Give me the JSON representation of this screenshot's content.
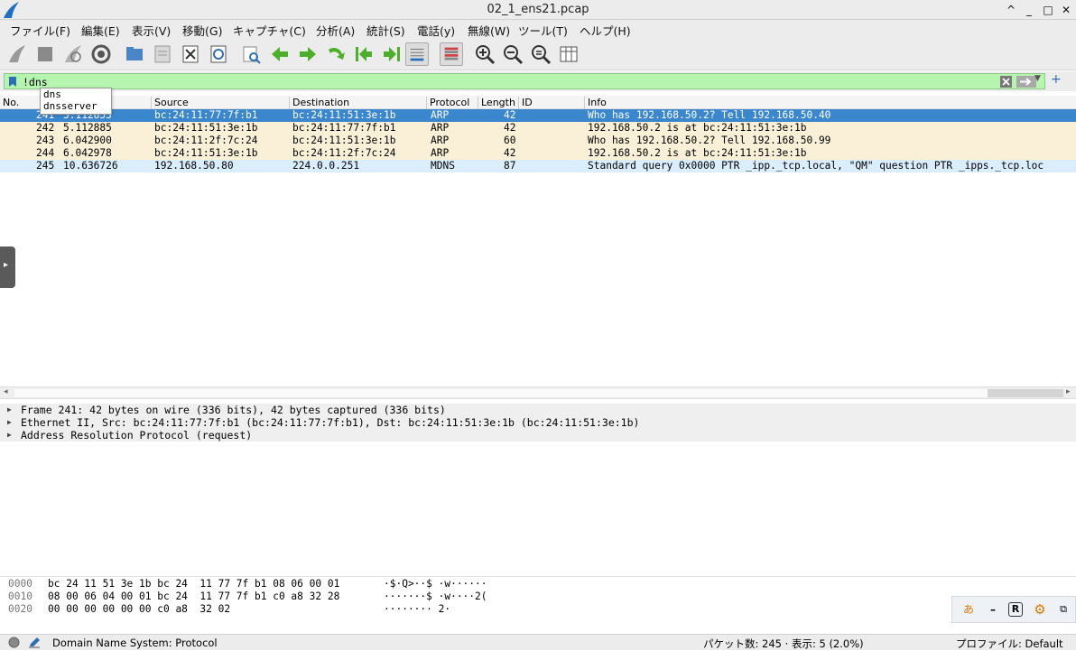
{
  "window": {
    "title": "02_1_ens21.pcap",
    "controls": [
      "^",
      "_",
      "□",
      "✕"
    ]
  },
  "menu": [
    "ファイル(F)",
    "編集(E)",
    "表示(V)",
    "移動(G)",
    "キャプチャ(C)",
    "分析(A)",
    "統計(S)",
    "電話(y)",
    "無線(W)",
    "ツール(T)",
    "ヘルプ(H)"
  ],
  "filter": {
    "value": "!dns",
    "suggestions": [
      "dns",
      "dnsserver"
    ]
  },
  "columns": [
    "No.",
    "Source",
    "Destination",
    "Protocol",
    "Length",
    "ID",
    "Info"
  ],
  "packets": [
    {
      "no": "241",
      "time": "5.112853",
      "src": "bc:24:11:77:7f:b1",
      "dst": "bc:24:11:51:3e:1b",
      "proto": "ARP",
      "len": "42",
      "info": "Who has 192.168.50.2? Tell 192.168.50.40",
      "kind": "sel"
    },
    {
      "no": "242",
      "time": "5.112885",
      "src": "bc:24:11:51:3e:1b",
      "dst": "bc:24:11:77:7f:b1",
      "proto": "ARP",
      "len": "42",
      "info": "192.168.50.2 is at bc:24:11:51:3e:1b",
      "kind": "arp"
    },
    {
      "no": "243",
      "time": "6.042900",
      "src": "bc:24:11:2f:7c:24",
      "dst": "bc:24:11:51:3e:1b",
      "proto": "ARP",
      "len": "60",
      "info": "Who has 192.168.50.2? Tell 192.168.50.99",
      "kind": "arp"
    },
    {
      "no": "244",
      "time": "6.042978",
      "src": "bc:24:11:51:3e:1b",
      "dst": "bc:24:11:2f:7c:24",
      "proto": "ARP",
      "len": "42",
      "info": "192.168.50.2 is at bc:24:11:51:3e:1b",
      "kind": "arp"
    },
    {
      "no": "245",
      "time": "10.636726",
      "src": "192.168.50.80",
      "dst": "224.0.0.251",
      "proto": "MDNS",
      "len": "87",
      "info": "Standard query 0x0000 PTR _ipp._tcp.local, \"QM\" question PTR _ipps._tcp.loc",
      "kind": "udp"
    }
  ],
  "details": [
    "Frame 241: 42 bytes on wire (336 bits), 42 bytes captured (336 bits)",
    "Ethernet II, Src: bc:24:11:77:7f:b1 (bc:24:11:77:7f:b1), Dst: bc:24:11:51:3e:1b (bc:24:11:51:3e:1b)",
    "Address Resolution Protocol (request)"
  ],
  "bytes": [
    {
      "offset": "0000",
      "hex": "bc 24 11 51 3e 1b bc 24  11 77 7f b1 08 06 00 01",
      "ascii": "·$·Q>··$ ·w······"
    },
    {
      "offset": "0010",
      "hex": "08 00 06 04 00 01 bc 24  11 77 7f b1 c0 a8 32 28",
      "ascii": "·······$ ·w····2("
    },
    {
      "offset": "0020",
      "hex": "00 00 00 00 00 00 c0 a8  32 02",
      "ascii": "········ 2·"
    }
  ],
  "status": {
    "field": "Domain Name System: Protocol",
    "packets": "パケット数: 245 · 表示: 5 (2.0%)",
    "profile": "プロファイル: Default"
  },
  "colors": {
    "filter_valid": "#b6f5b0",
    "selected_row": "#3a87ce",
    "arp_row": "#faf0d7",
    "udp_row": "#daeeff"
  }
}
